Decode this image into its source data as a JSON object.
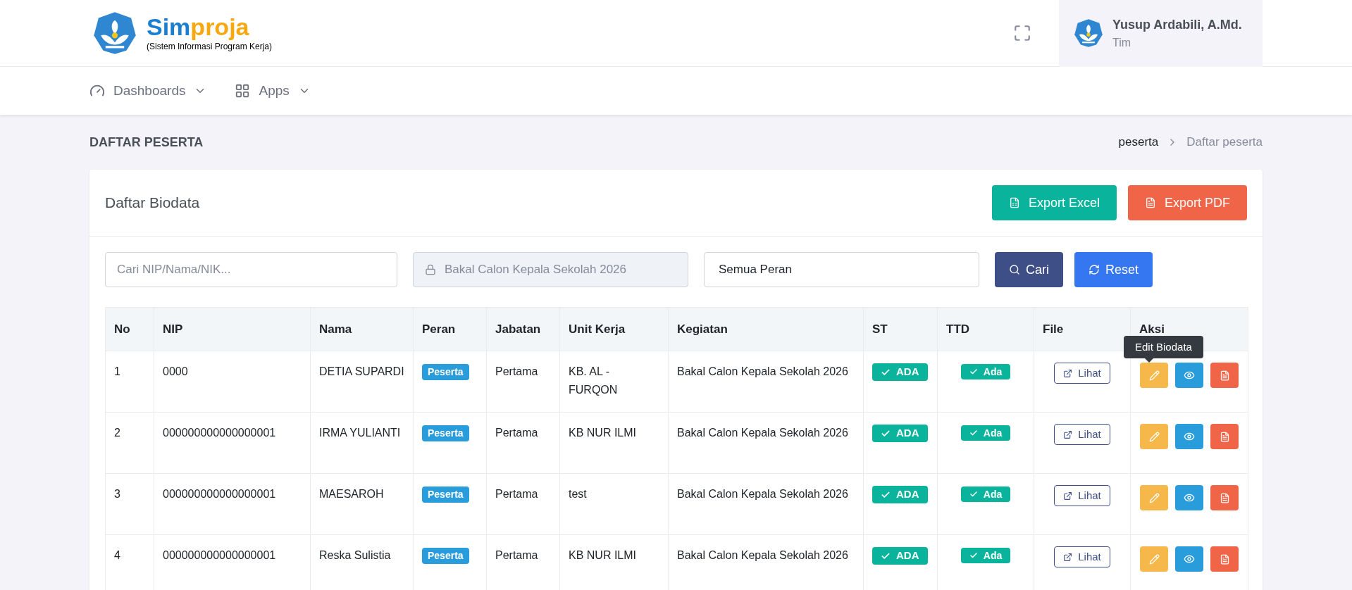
{
  "brand": {
    "name_primary": "Sim",
    "name_accent": "proja",
    "subtitle": "(Sistem Informasi Program Kerja)"
  },
  "user": {
    "name": "Yusup Ardabili, A.Md.",
    "role": "Tim"
  },
  "nav": [
    {
      "label": "Dashboards"
    },
    {
      "label": "Apps"
    }
  ],
  "page_title": "DAFTAR PESERTA",
  "breadcrumb": [
    "peserta",
    "Daftar peserta"
  ],
  "card": {
    "title": "Daftar Biodata",
    "export_buttons": [
      {
        "label": "Export Excel",
        "kind": "excel"
      },
      {
        "label": "Export PDF",
        "kind": "pdf"
      }
    ]
  },
  "filters": {
    "search": {
      "placeholder": "Cari NIP/Nama/NIK..."
    },
    "event": {
      "value": "Bakal Calon Kepala Sekolah 2026",
      "disabled": true
    },
    "role": {
      "value": "Semua Peran"
    },
    "buttons": [
      {
        "label": "Cari",
        "kind": "search"
      },
      {
        "label": "Reset",
        "kind": "reset"
      }
    ]
  },
  "table": {
    "columns": [
      "No",
      "NIP",
      "Nama",
      "Peran",
      "Jabatan",
      "Unit Kerja",
      "Kegiatan",
      "ST",
      "TTD",
      "File",
      "Aksi"
    ],
    "rows": [
      {
        "no": "1",
        "nip": "0000",
        "nama": "DETIA SUPARDI",
        "peran": "Peserta",
        "jabatan": "Pertama",
        "unit_kerja": "KB. AL - FURQON",
        "kegiatan": "Bakal Calon Kepala Sekolah 2026",
        "st": "ADA",
        "ttd": "Ada",
        "file": "Lihat",
        "tooltip": "Edit Biodata"
      },
      {
        "no": "2",
        "nip": "000000000000000001",
        "nama": "IRMA YULIANTI",
        "peran": "Peserta",
        "jabatan": "Pertama",
        "unit_kerja": "KB NUR ILMI",
        "kegiatan": "Bakal Calon Kepala Sekolah 2026",
        "st": "ADA",
        "ttd": "Ada",
        "file": "Lihat"
      },
      {
        "no": "3",
        "nip": "000000000000000001",
        "nama": "MAESAROH",
        "peran": "Peserta",
        "jabatan": "Pertama",
        "unit_kerja": "test",
        "kegiatan": "Bakal Calon Kepala Sekolah 2026",
        "st": "ADA",
        "ttd": "Ada",
        "file": "Lihat"
      },
      {
        "no": "4",
        "nip": "000000000000000001",
        "nama": "Reska Sulistia",
        "peran": "Peserta",
        "jabatan": "Pertama",
        "unit_kerja": "KB NUR ILMI",
        "kegiatan": "Bakal Calon Kepala Sekolah 2026",
        "st": "ADA",
        "ttd": "Ada",
        "file": "Lihat"
      }
    ]
  }
}
